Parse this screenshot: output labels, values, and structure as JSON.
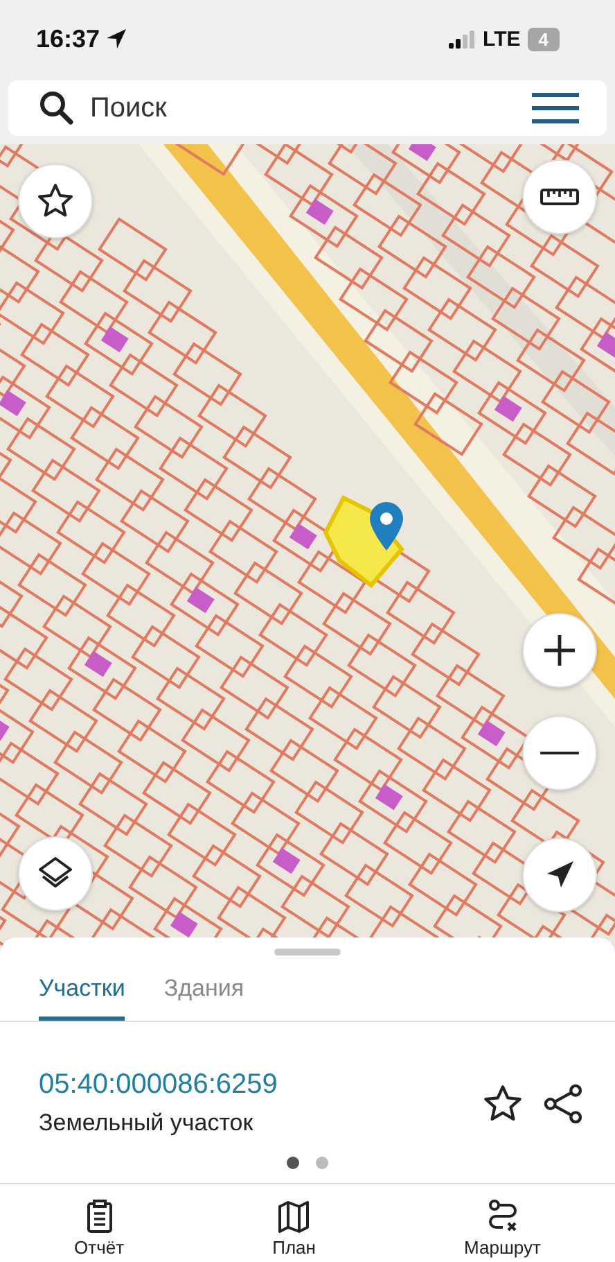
{
  "status_bar": {
    "time": "16:37",
    "network": "LTE",
    "battery": "4"
  },
  "search": {
    "placeholder": "Поиск"
  },
  "sheet": {
    "tabs": [
      {
        "label": "Участки",
        "selected": true
      },
      {
        "label": "Здания",
        "selected": false
      }
    ],
    "parcel": {
      "cadastral_number": "05:40:000086:6259",
      "type": "Земельный участок"
    },
    "pager": [
      {
        "selected": true
      },
      {
        "selected": false
      }
    ]
  },
  "bottom_nav": [
    {
      "label": "Отчёт",
      "kind": "report"
    },
    {
      "label": "План",
      "kind": "plan"
    },
    {
      "label": "Маршрут",
      "kind": "route"
    }
  ]
}
